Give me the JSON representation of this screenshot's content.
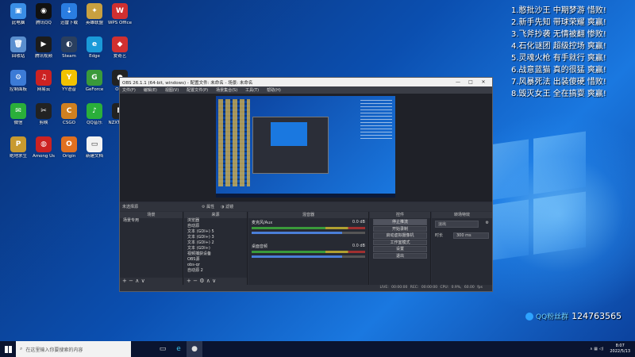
{
  "desktop_icons": [
    {
      "label": "此电脑",
      "color": "#3a8ee6",
      "sym": "▣"
    },
    {
      "label": "腾讯QQ",
      "color": "#111",
      "sym": "◉"
    },
    {
      "label": "迅雷下载",
      "color": "#2a7de1",
      "sym": "⇣"
    },
    {
      "label": "英雄联盟",
      "color": "#c8a040",
      "sym": "✦"
    },
    {
      "label": "WPS Office",
      "color": "#d03030",
      "sym": "W"
    },
    {
      "label": "回收站",
      "color": "#5a8fcf",
      "sym": "🗑"
    },
    {
      "label": "腾讯视频",
      "color": "#1c1c1c",
      "sym": "▶"
    },
    {
      "label": "Steam",
      "color": "#2a3f5f",
      "sym": "◐"
    },
    {
      "label": "Edge",
      "color": "#1a9ad8",
      "sym": "e"
    },
    {
      "label": "爱奇艺",
      "color": "#d03030",
      "sym": "◆"
    },
    {
      "label": "控制面板",
      "color": "#3c7bd6",
      "sym": "⚙"
    },
    {
      "label": "网易云",
      "color": "#c22",
      "sym": "♫"
    },
    {
      "label": "YY语音",
      "color": "#f2c200",
      "sym": "Y"
    },
    {
      "label": "GeForce",
      "color": "#3a9a3a",
      "sym": "G"
    },
    {
      "label": "OBS",
      "color": "#222",
      "sym": "●"
    },
    {
      "label": "微信",
      "color": "#2aaf3a",
      "sym": "✉"
    },
    {
      "label": "剪映",
      "color": "#222",
      "sym": "✂"
    },
    {
      "label": "CSGO",
      "color": "#d08020",
      "sym": "C"
    },
    {
      "label": "QQ音乐",
      "color": "#2aaf3a",
      "sym": "♪"
    },
    {
      "label": "NZXT CAM",
      "color": "#222",
      "sym": "N"
    },
    {
      "label": "绝地求生",
      "color": "#c89a30",
      "sym": "P"
    },
    {
      "label": "Among Us",
      "color": "#c22",
      "sym": "◍"
    },
    {
      "label": "Origin",
      "color": "#e07020",
      "sym": "O"
    },
    {
      "label": "新建文档",
      "color": "#f2f2f2",
      "sym": "▭"
    }
  ],
  "rank_list": [
    "1.憨批沙王 中期梦游 惜败!",
    "2.新手先知 带球荣耀 爽赢!",
    "3.飞斧抄袭 无情被翻 惨败!",
    "4.石化谜团 超级控场 爽赢!",
    "5.灵魂火枪 有手就行 爽赢!",
    "6.战意蓝猫 真的很猛 爽赢!",
    "7.风暴死法 出装傻硬 惜败!",
    "8.毁灭女王 全在搞耍 爽赢!"
  ],
  "qq_overlay": {
    "name": "QQ粉丝群",
    "number": "124763565"
  },
  "obs": {
    "title": "OBS 26.1.1 (64-bit, windows) - 配置文件: 未命名 - 场景: 未命名",
    "menu": [
      "文件(F)",
      "编辑(E)",
      "视图(V)",
      "配置文件(P)",
      "场景集合(S)",
      "工具(T)",
      "帮助(H)"
    ],
    "scene_label": "未选择源",
    "scene_tools": [
      "属性",
      "滤镜"
    ],
    "docks": {
      "scenes": {
        "header": "场景",
        "items": [
          "场景专用"
        ]
      },
      "sources": {
        "header": "来源",
        "items": [
          "浏览器",
          "自动源",
          "文本 (GDI+) 5",
          "文本 (GDI+) 3",
          "文本 (GDI+) 2",
          "文本 (GDI+)",
          "视频捕获设备",
          "OBS源",
          "obs-qr",
          "自动源 2"
        ]
      },
      "mixer": {
        "header": "混音器",
        "channels": [
          {
            "name": "麦克风/Aux",
            "db": "0.0 dB"
          },
          {
            "name": "桌面音频",
            "db": "0.0 dB"
          }
        ]
      },
      "controls": {
        "header": "控件",
        "buttons": [
          "停止推流",
          "开始录制",
          "启动虚拟摄像机",
          "工作室模式",
          "设置",
          "退出"
        ]
      },
      "transitions": {
        "header": "转场特效",
        "type": "淡出",
        "duration_label": "时长",
        "duration": "300 ms"
      }
    },
    "status": "LIVE: 00:00:00   REC: 00:00:00   CPU: 0.9%, 60.00 fps"
  },
  "taskbar": {
    "search_placeholder": "在这里输入你要搜索的内容",
    "time": "8:07",
    "date": "2022/5/13"
  }
}
